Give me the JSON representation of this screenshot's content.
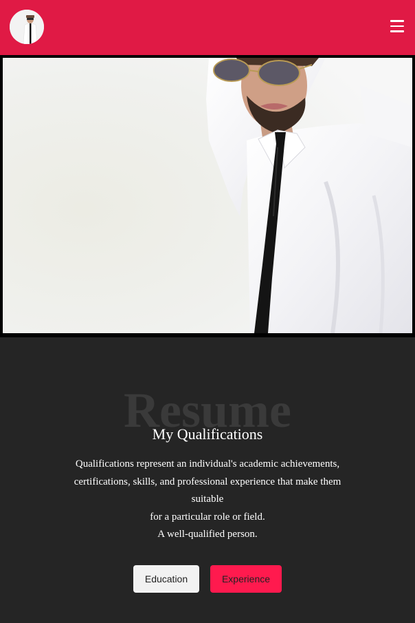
{
  "header": {
    "avatar_icon": "profile-photo",
    "menu_icon": "hamburger-menu-icon",
    "background_color": "#e01a45"
  },
  "hero": {
    "image": "man-in-white-shirt-black-tie-sunglasses"
  },
  "resume": {
    "watermark": "Resume",
    "title": "My Qualifications",
    "description_lines": [
      "Qualifications represent an individual's academic achievements,",
      "certifications, skills, and professional experience that make them",
      "suitable",
      "for a particular role or field.",
      "A well-qualified person."
    ],
    "buttons": {
      "education": "Education",
      "experience": "Experience"
    },
    "accent_color": "#ff1a4e"
  }
}
